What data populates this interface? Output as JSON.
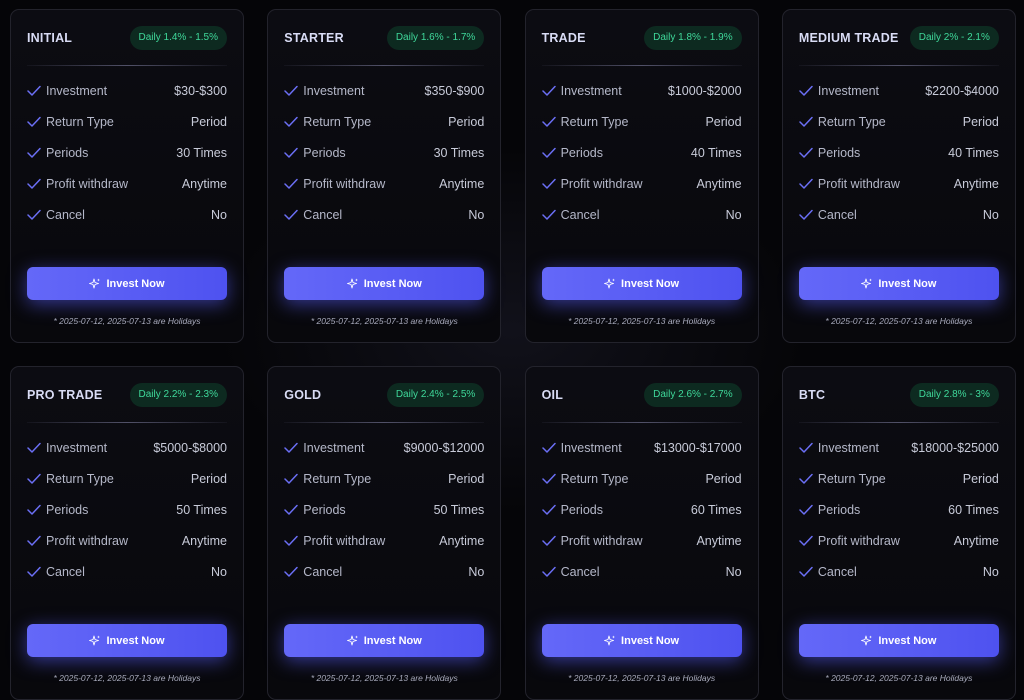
{
  "button_label": "Invest Now",
  "holiday_note": "* 2025-07-12, 2025-07-13 are Holidays",
  "feature_labels": {
    "investment": "Investment",
    "return_type": "Return Type",
    "periods": "Periods",
    "profit_withdraw": "Profit withdraw",
    "cancel": "Cancel"
  },
  "colors": {
    "accent": "#5a5ef5",
    "badge_text": "#3fd89a",
    "badge_bg": "#0d2a20",
    "check": "#6b6ff5"
  },
  "plans": [
    {
      "name": "INITIAL",
      "rate": "Daily 1.4% - 1.5%",
      "investment": "$30-$300",
      "return_type": "Period",
      "periods": "30 Times",
      "profit_withdraw": "Anytime",
      "cancel": "No"
    },
    {
      "name": "STARTER",
      "rate": "Daily 1.6% - 1.7%",
      "investment": "$350-$900",
      "return_type": "Period",
      "periods": "30 Times",
      "profit_withdraw": "Anytime",
      "cancel": "No"
    },
    {
      "name": "TRADE",
      "rate": "Daily 1.8% - 1.9%",
      "investment": "$1000-$2000",
      "return_type": "Period",
      "periods": "40 Times",
      "profit_withdraw": "Anytime",
      "cancel": "No"
    },
    {
      "name": "MEDIUM TRADE",
      "rate": "Daily 2% - 2.1%",
      "investment": "$2200-$4000",
      "return_type": "Period",
      "periods": "40 Times",
      "profit_withdraw": "Anytime",
      "cancel": "No"
    },
    {
      "name": "PRO TRADE",
      "rate": "Daily 2.2% - 2.3%",
      "investment": "$5000-$8000",
      "return_type": "Period",
      "periods": "50 Times",
      "profit_withdraw": "Anytime",
      "cancel": "No"
    },
    {
      "name": "GOLD",
      "rate": "Daily 2.4% - 2.5%",
      "investment": "$9000-$12000",
      "return_type": "Period",
      "periods": "50 Times",
      "profit_withdraw": "Anytime",
      "cancel": "No"
    },
    {
      "name": "OIL",
      "rate": "Daily 2.6% - 2.7%",
      "investment": "$13000-$17000",
      "return_type": "Period",
      "periods": "60 Times",
      "profit_withdraw": "Anytime",
      "cancel": "No"
    },
    {
      "name": "BTC",
      "rate": "Daily 2.8% - 3%",
      "investment": "$18000-$25000",
      "return_type": "Period",
      "periods": "60 Times",
      "profit_withdraw": "Anytime",
      "cancel": "No"
    }
  ]
}
